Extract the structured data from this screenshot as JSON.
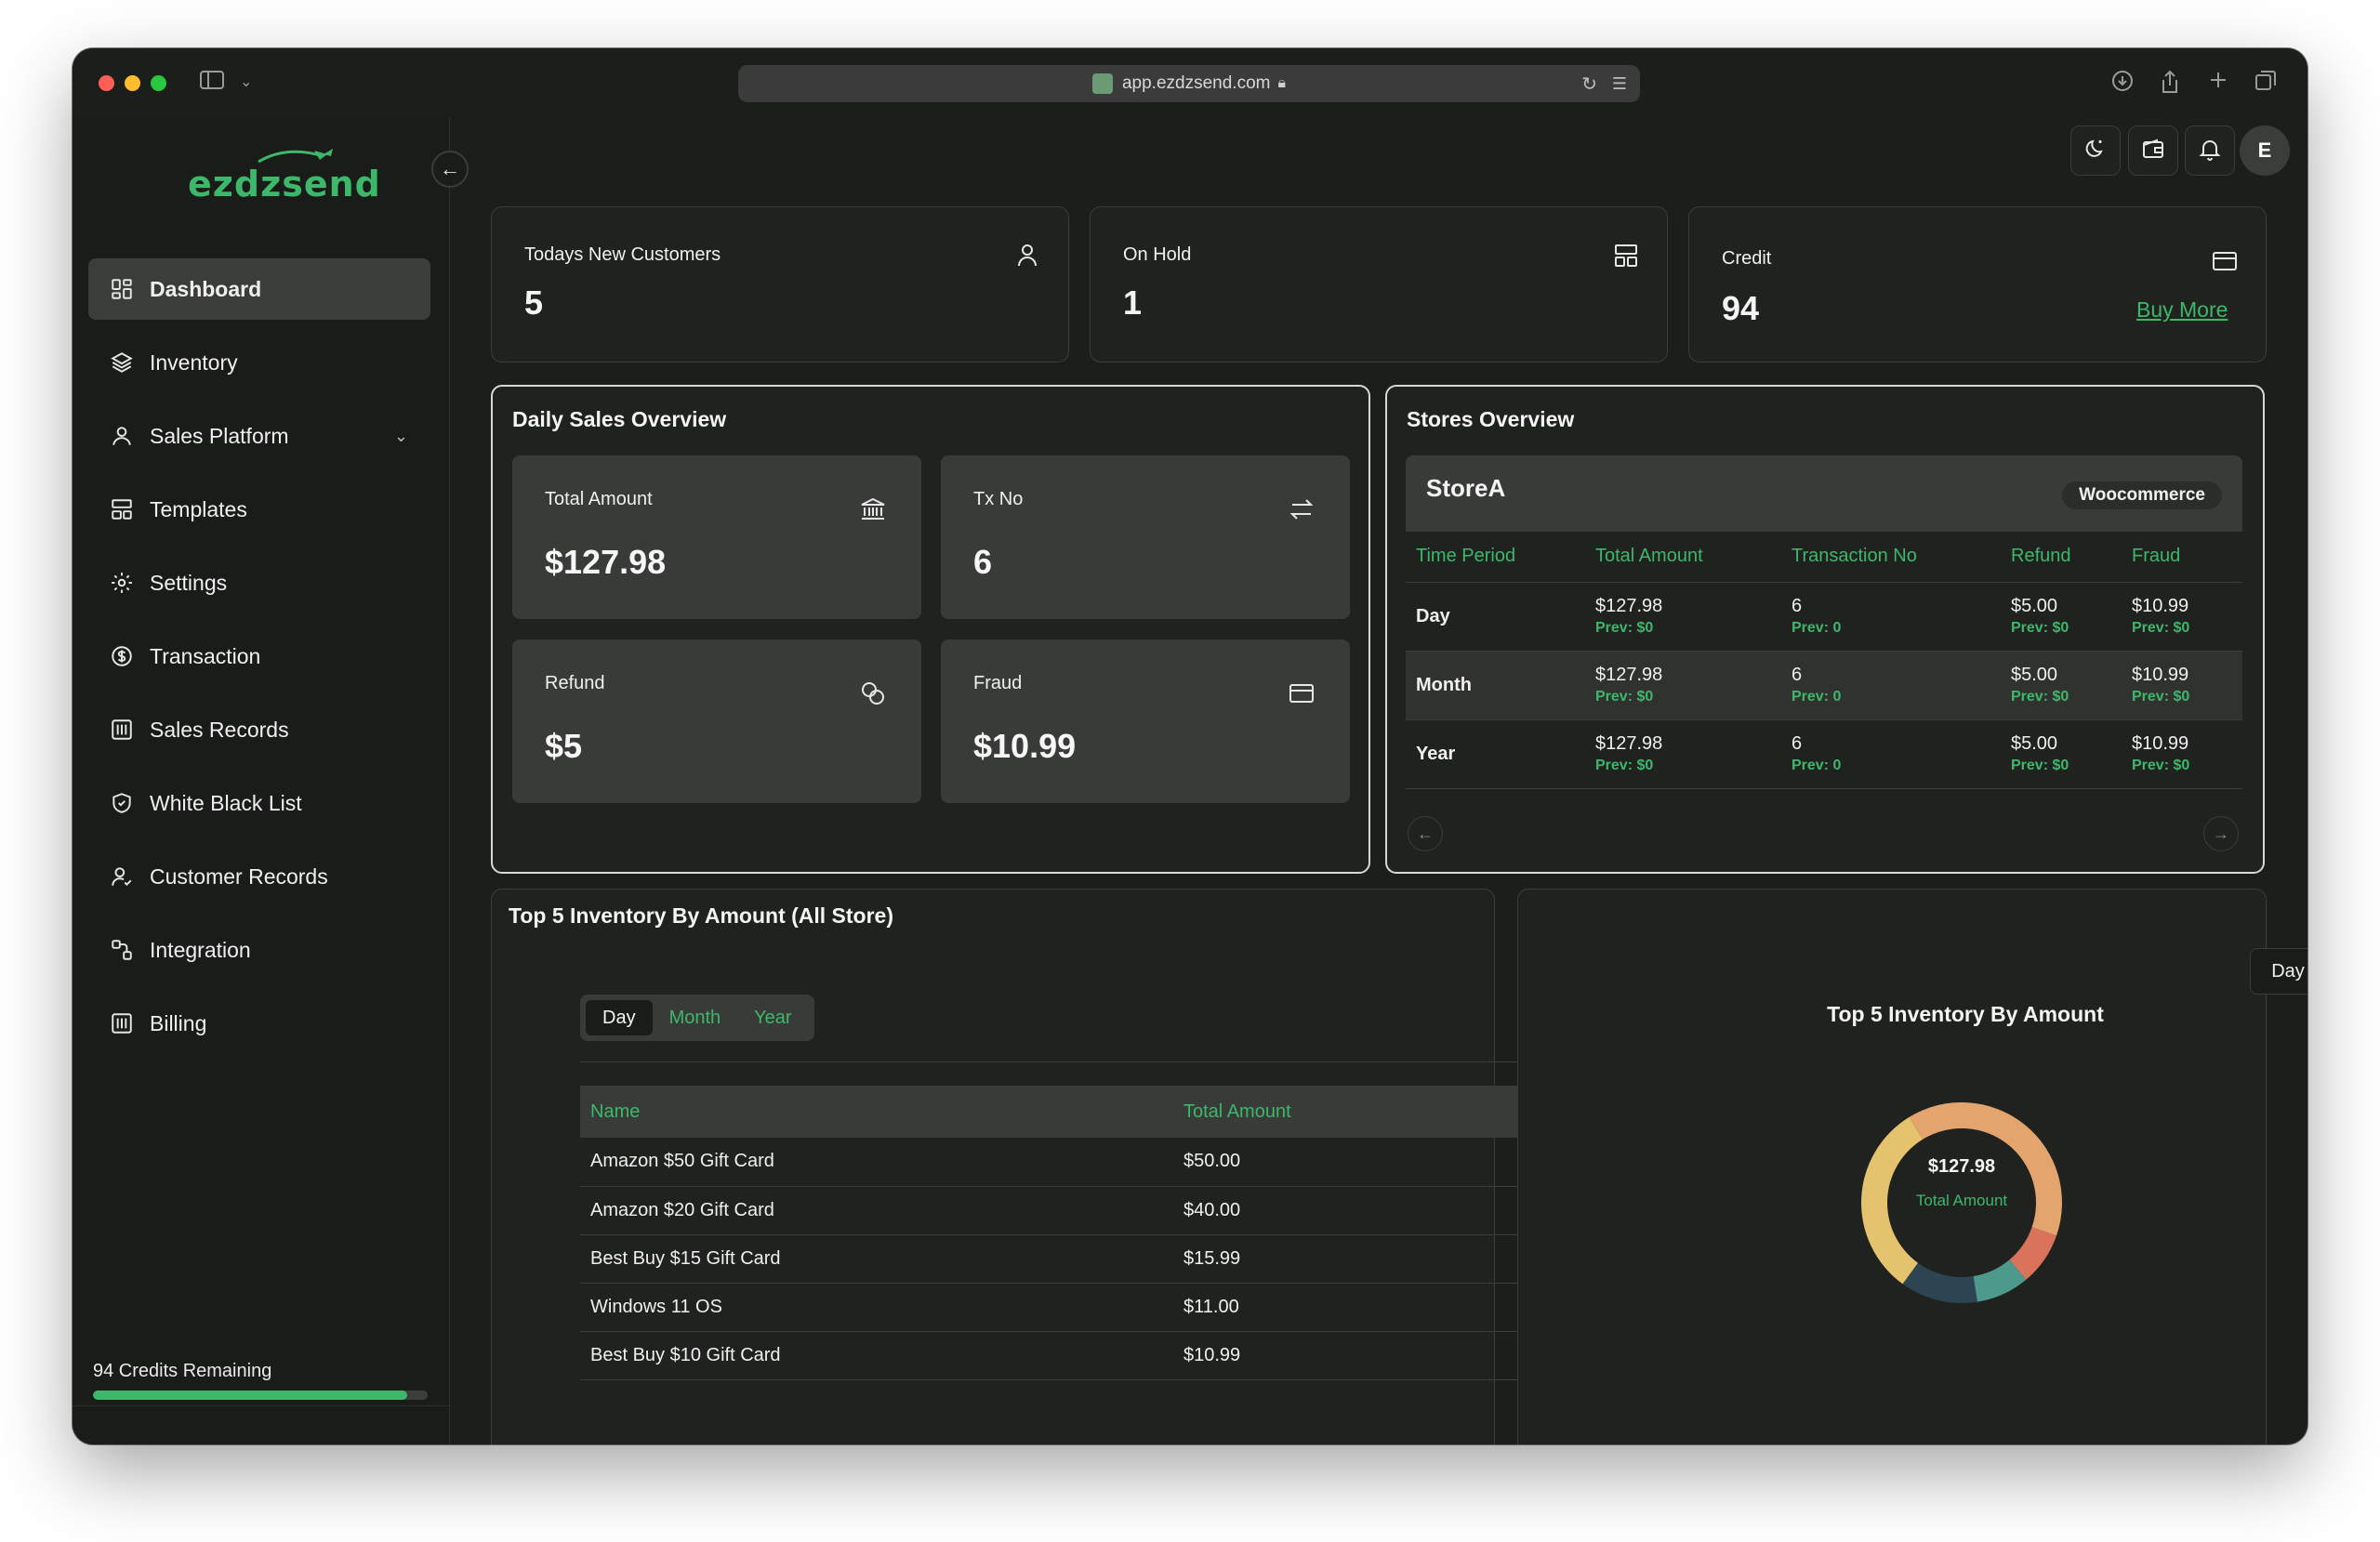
{
  "browser": {
    "url": "app.ezdzsend.com"
  },
  "brand": {
    "logo_text": "ezdzsend",
    "accent": "#3db86a"
  },
  "sidebar": {
    "items": [
      {
        "label": "Dashboard",
        "icon": "dashboard-icon",
        "active": true
      },
      {
        "label": "Inventory",
        "icon": "layers-icon"
      },
      {
        "label": "Sales Platform",
        "icon": "user-icon",
        "has_chevron": true
      },
      {
        "label": "Templates",
        "icon": "templates-icon"
      },
      {
        "label": "Settings",
        "icon": "gear-icon"
      },
      {
        "label": "Transaction",
        "icon": "dollar-circle-icon"
      },
      {
        "label": "Sales Records",
        "icon": "records-icon"
      },
      {
        "label": "White Black List",
        "icon": "shield-icon"
      },
      {
        "label": "Customer Records",
        "icon": "user-check-icon"
      },
      {
        "label": "Integration",
        "icon": "integration-icon"
      },
      {
        "label": "Billing",
        "icon": "billing-icon"
      }
    ],
    "credits_text": "94 Credits Remaining",
    "credits_progress": 0.94
  },
  "header": {
    "avatar_initial": "E"
  },
  "stats": {
    "new_customers": {
      "label": "Todays New Customers",
      "value": "5"
    },
    "on_hold": {
      "label": "On Hold",
      "value": "1"
    },
    "credit": {
      "label": "Credit",
      "value": "94",
      "action": "Buy More"
    }
  },
  "daily_sales": {
    "title": "Daily Sales Overview",
    "total_amount": {
      "label": "Total Amount",
      "value": "$127.98"
    },
    "tx_no": {
      "label": "Tx No",
      "value": "6"
    },
    "refund": {
      "label": "Refund",
      "value": "$5"
    },
    "fraud": {
      "label": "Fraud",
      "value": "$10.99"
    }
  },
  "stores": {
    "title": "Stores Overview",
    "store_name": "StoreA",
    "platform": "Woocommerce",
    "columns": [
      "Time Period",
      "Total Amount",
      "Transaction No",
      "Refund",
      "Fraud"
    ],
    "rows": [
      {
        "period": "Day",
        "amount": "$127.98",
        "amount_prev": "Prev: $0",
        "tx": "6",
        "tx_prev": "Prev: 0",
        "refund": "$5.00",
        "refund_prev": "Prev: $0",
        "fraud": "$10.99",
        "fraud_prev": "Prev: $0"
      },
      {
        "period": "Month",
        "amount": "$127.98",
        "amount_prev": "Prev: $0",
        "tx": "6",
        "tx_prev": "Prev: 0",
        "refund": "$5.00",
        "refund_prev": "Prev: $0",
        "fraud": "$10.99",
        "fraud_prev": "Prev: $0"
      },
      {
        "period": "Year",
        "amount": "$127.98",
        "amount_prev": "Prev: $0",
        "tx": "6",
        "tx_prev": "Prev: 0",
        "refund": "$5.00",
        "refund_prev": "Prev: $0",
        "fraud": "$10.99",
        "fraud_prev": "Prev: $0"
      }
    ]
  },
  "top_inventory": {
    "title": "Top 5 Inventory By Amount (All Store)",
    "tabs": [
      "Day",
      "Month",
      "Year"
    ],
    "active_tab": "Day",
    "columns": [
      "Name",
      "Total Amount"
    ],
    "rows": [
      {
        "name": "Amazon $50 Gift Card",
        "amount": "$50.00"
      },
      {
        "name": "Amazon $20 Gift Card",
        "amount": "$40.00"
      },
      {
        "name": "Best Buy $15 Gift Card",
        "amount": "$15.99"
      },
      {
        "name": "Windows 11 OS",
        "amount": "$11.00"
      },
      {
        "name": "Best Buy $10 Gift Card",
        "amount": "$10.99"
      }
    ]
  },
  "donut": {
    "title": "Top 5 Inventory By Amount",
    "range_button": "Day",
    "center_value": "$127.98",
    "center_label": "Total Amount"
  },
  "chart_data": {
    "type": "pie",
    "title": "Top 5 Inventory By Amount",
    "categories": [
      "Amazon $50 Gift Card",
      "Amazon $20 Gift Card",
      "Best Buy $15 Gift Card",
      "Windows 11 OS",
      "Best Buy $10 Gift Card"
    ],
    "values": [
      50.0,
      40.0,
      15.99,
      11.0,
      10.99
    ],
    "colors": [
      "#e4a46e",
      "#e4c26e",
      "#2d4552",
      "#4d9a8c",
      "#d9735c"
    ],
    "donut": true
  }
}
